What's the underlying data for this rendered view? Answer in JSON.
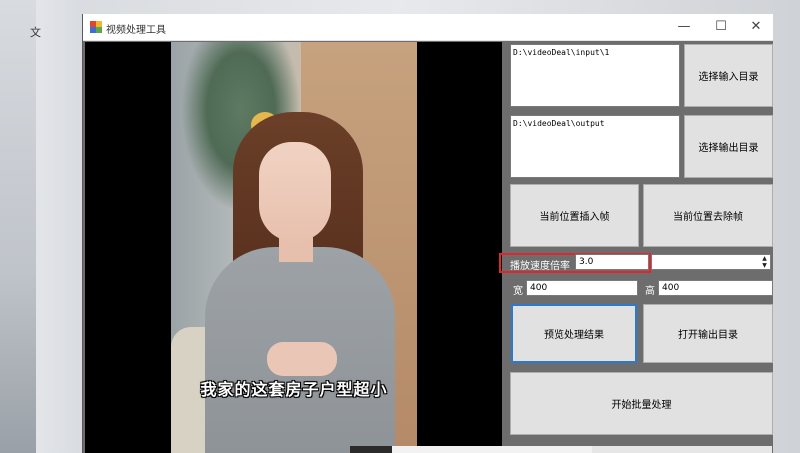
{
  "window": {
    "title": "视频处理工具",
    "minimize_glyph": "—",
    "maximize_glyph": "☐",
    "close_glyph": "✕"
  },
  "desktop": {
    "glyph": "文"
  },
  "video": {
    "subtitle": "我家的这套房子户型超小"
  },
  "io": {
    "input_path": "D:\\videoDeal\\input\\1",
    "input_button": "选择输入目录",
    "output_path": "D:\\videoDeal\\output",
    "output_button": "选择输出目录"
  },
  "frame_buttons": {
    "insert": "当前位置插入帧",
    "remove": "当前位置去除帧"
  },
  "speed": {
    "label": "播放速度倍率",
    "value": "3.0",
    "spin_up": "▲",
    "spin_down": "▼"
  },
  "size": {
    "width_label": "宽",
    "width_value": "400",
    "height_label": "高",
    "height_value": "400"
  },
  "actions": {
    "preview": "预览处理结果",
    "open_output": "打开输出目录",
    "start_batch": "开始批量处理"
  },
  "colors": {
    "highlight": "#e0262a",
    "focus": "#2b7ad0",
    "panel_bg": "#6d6d6d",
    "button_bg": "#e1e1e1"
  }
}
